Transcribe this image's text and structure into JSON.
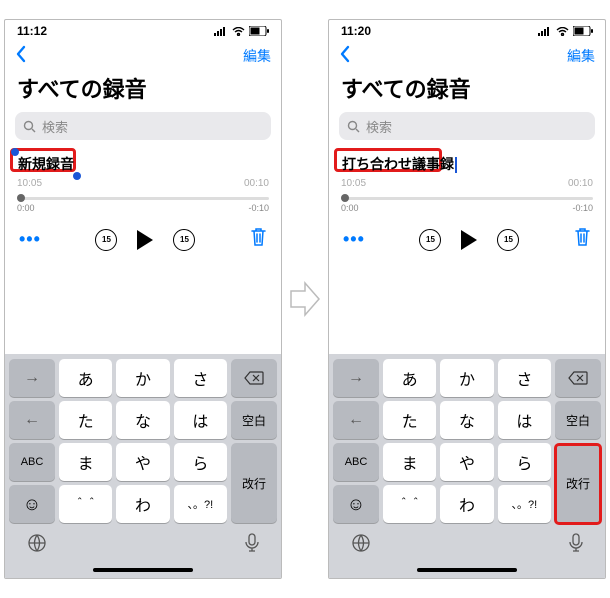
{
  "left": {
    "status": {
      "time": "11:12"
    },
    "header": {
      "edit": "編集"
    },
    "title": "すべての録音",
    "search": {
      "placeholder": "検索"
    },
    "recording": {
      "name": "新規録音",
      "time": "10:05",
      "duration": "00:10"
    },
    "scrubber": {
      "start": "0:00",
      "end": "-0:10"
    },
    "skip15": "15"
  },
  "right": {
    "status": {
      "time": "11:20"
    },
    "header": {
      "edit": "編集"
    },
    "title": "すべての録音",
    "search": {
      "placeholder": "検索"
    },
    "recording": {
      "name": "打ち合わせ議事録",
      "time": "10:05",
      "duration": "00:10"
    },
    "scrubber": {
      "start": "0:00",
      "end": "-0:10"
    },
    "skip15": "15"
  },
  "keyboard": {
    "rows": [
      [
        "→",
        "あ",
        "か",
        "さ",
        "⌫"
      ],
      [
        "←",
        "た",
        "な",
        "は",
        "空白"
      ],
      [
        "ABC",
        "ま",
        "や",
        "ら",
        "改行"
      ],
      [
        "☺",
        "＾＾",
        "わ",
        "、。?!",
        ""
      ]
    ],
    "return_label": "改行",
    "space_label": "空白"
  }
}
